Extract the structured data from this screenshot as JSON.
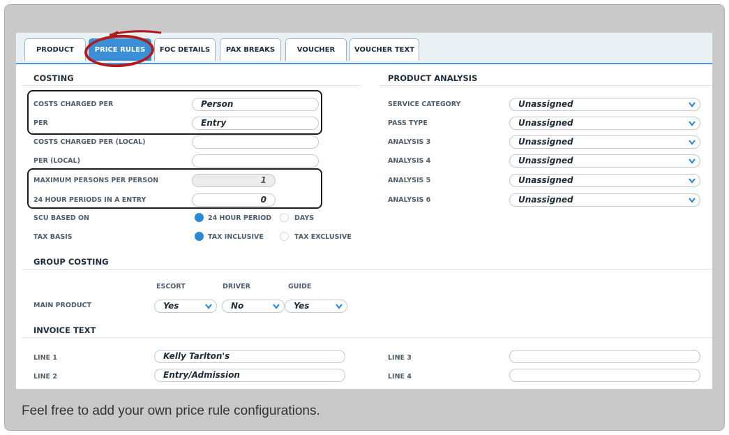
{
  "tabs": [
    {
      "label": "PRODUCT",
      "active": false
    },
    {
      "label": "PRICE RULES",
      "active": true
    },
    {
      "label": "FOC DETAILS",
      "active": false
    },
    {
      "label": "PAX BREAKS",
      "active": false
    },
    {
      "label": "VOUCHER",
      "active": false
    },
    {
      "label": "VOUCHER TEXT",
      "active": false
    }
  ],
  "costing": {
    "title": "COSTING",
    "costs_charged_per": {
      "label": "COSTS CHARGED PER",
      "value": "Person"
    },
    "per": {
      "label": "PER",
      "value": "Entry"
    },
    "costs_charged_per_local": {
      "label": "COSTS CHARGED PER (LOCAL)",
      "value": ""
    },
    "per_local": {
      "label": "PER (LOCAL)",
      "value": ""
    },
    "max_persons": {
      "label": "MAXIMUM PERSONS PER PERSON",
      "value": "1"
    },
    "periods": {
      "label": "24 HOUR PERIODS IN A ENTRY",
      "value": "0"
    },
    "scu": {
      "label": "SCU BASED ON",
      "option1": "24 HOUR PERIOD",
      "option2": "DAYS"
    },
    "tax": {
      "label": "TAX BASIS",
      "option1": "TAX INCLUSIVE",
      "option2": "TAX EXCLUSIVE"
    }
  },
  "analysis": {
    "title": "PRODUCT ANALYSIS",
    "rows": [
      {
        "label": "SERVICE CATEGORY",
        "value": "Unassigned"
      },
      {
        "label": "PASS TYPE",
        "value": "Unassigned"
      },
      {
        "label": "ANALYSIS 3",
        "value": "Unassigned"
      },
      {
        "label": "ANALYSIS 4",
        "value": "Unassigned"
      },
      {
        "label": "ANALYSIS 5",
        "value": "Unassigned"
      },
      {
        "label": "ANALYSIS 6",
        "value": "Unassigned"
      }
    ]
  },
  "group_costing": {
    "title": "GROUP COSTING",
    "col_escort": "ESCORT",
    "col_driver": "DRIVER",
    "col_guide": "GUIDE",
    "row_label": "MAIN PRODUCT",
    "escort": "Yes",
    "driver": "No",
    "guide": "Yes"
  },
  "invoice": {
    "title": "INVOICE TEXT",
    "line1": {
      "label": "LINE 1",
      "value": "Kelly Tarlton's"
    },
    "line2": {
      "label": "LINE 2",
      "value": "Entry/Admission"
    },
    "line3": {
      "label": "LINE 3",
      "value": ""
    },
    "line4": {
      "label": "LINE 4",
      "value": ""
    }
  },
  "caption": "Feel free to add your own price rule configurations.",
  "colors": {
    "accent": "#3b8fd7",
    "annotation": "#b01c1c"
  }
}
